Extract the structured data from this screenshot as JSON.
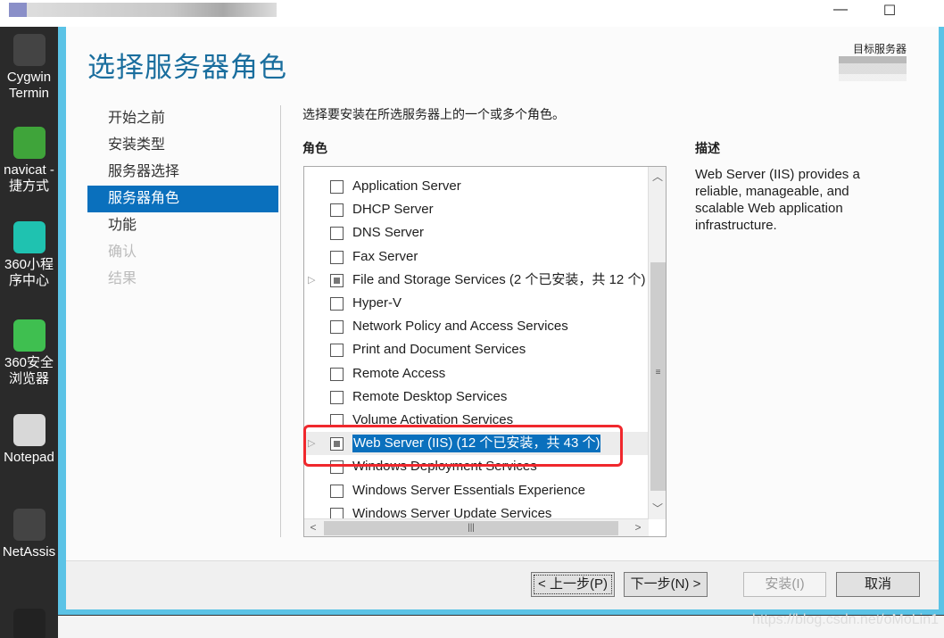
{
  "window": {
    "minimize_icon": "minimize-icon",
    "maximize_icon": "maximize-icon"
  },
  "desktop": [
    {
      "label": "Cygwin Termin",
      "color": "#444"
    },
    {
      "label": "navicat - 捷方式",
      "color": "#3fa43a"
    },
    {
      "label": "360小程序中心",
      "color": "#1fc2b0"
    },
    {
      "label": "360安全浏览器",
      "color": "#3fbf50"
    },
    {
      "label": "Notepad",
      "color": "#d8d8d8"
    },
    {
      "label": "NetAssis",
      "color": "#444"
    },
    {
      "label": "IJ",
      "color": "#222"
    }
  ],
  "dialog": {
    "title": "选择服务器角色",
    "target_server": "目标服务器",
    "nav": [
      {
        "label": "开始之前",
        "state": "normal"
      },
      {
        "label": "安装类型",
        "state": "normal"
      },
      {
        "label": "服务器选择",
        "state": "normal"
      },
      {
        "label": "服务器角色",
        "state": "selected"
      },
      {
        "label": "功能",
        "state": "normal"
      },
      {
        "label": "确认",
        "state": "disabled"
      },
      {
        "label": "结果",
        "state": "disabled"
      }
    ],
    "instruction": "选择要安装在所选服务器上的一个或多个角色。",
    "roles_header": "角色",
    "description_header": "描述",
    "description": "Web Server (IIS) provides a reliable, manageable, and scalable Web application infrastructure.",
    "roles": [
      {
        "label": "Application Server",
        "check": "none",
        "expandable": false
      },
      {
        "label": "DHCP Server",
        "check": "none",
        "expandable": false
      },
      {
        "label": "DNS Server",
        "check": "none",
        "expandable": false
      },
      {
        "label": "Fax Server",
        "check": "none",
        "expandable": false
      },
      {
        "label": "File and Storage Services (2 个已安装，共 12 个)",
        "check": "partial",
        "expandable": true
      },
      {
        "label": "Hyper-V",
        "check": "none",
        "expandable": false
      },
      {
        "label": "Network Policy and Access Services",
        "check": "none",
        "expandable": false
      },
      {
        "label": "Print and Document Services",
        "check": "none",
        "expandable": false
      },
      {
        "label": "Remote Access",
        "check": "none",
        "expandable": false
      },
      {
        "label": "Remote Desktop Services",
        "check": "none",
        "expandable": false
      },
      {
        "label": "Volume Activation Services",
        "check": "none",
        "expandable": false
      },
      {
        "label": "Web Server (IIS) (12 个已安装，共 43 个)",
        "check": "partial",
        "expandable": true,
        "selected": true
      },
      {
        "label": "Windows Deployment Services",
        "check": "none",
        "expandable": false
      },
      {
        "label": "Windows Server Essentials Experience",
        "check": "none",
        "expandable": false
      },
      {
        "label": "Windows Server Update Services",
        "check": "none",
        "expandable": false
      }
    ],
    "buttons": {
      "prev": "< 上一步(P)",
      "next": "下一步(N) >",
      "install": "安装(I)",
      "cancel": "取消"
    },
    "highlight_color": "#f0282d"
  },
  "watermark": "https://blog.csdn.net/oMoLin1"
}
